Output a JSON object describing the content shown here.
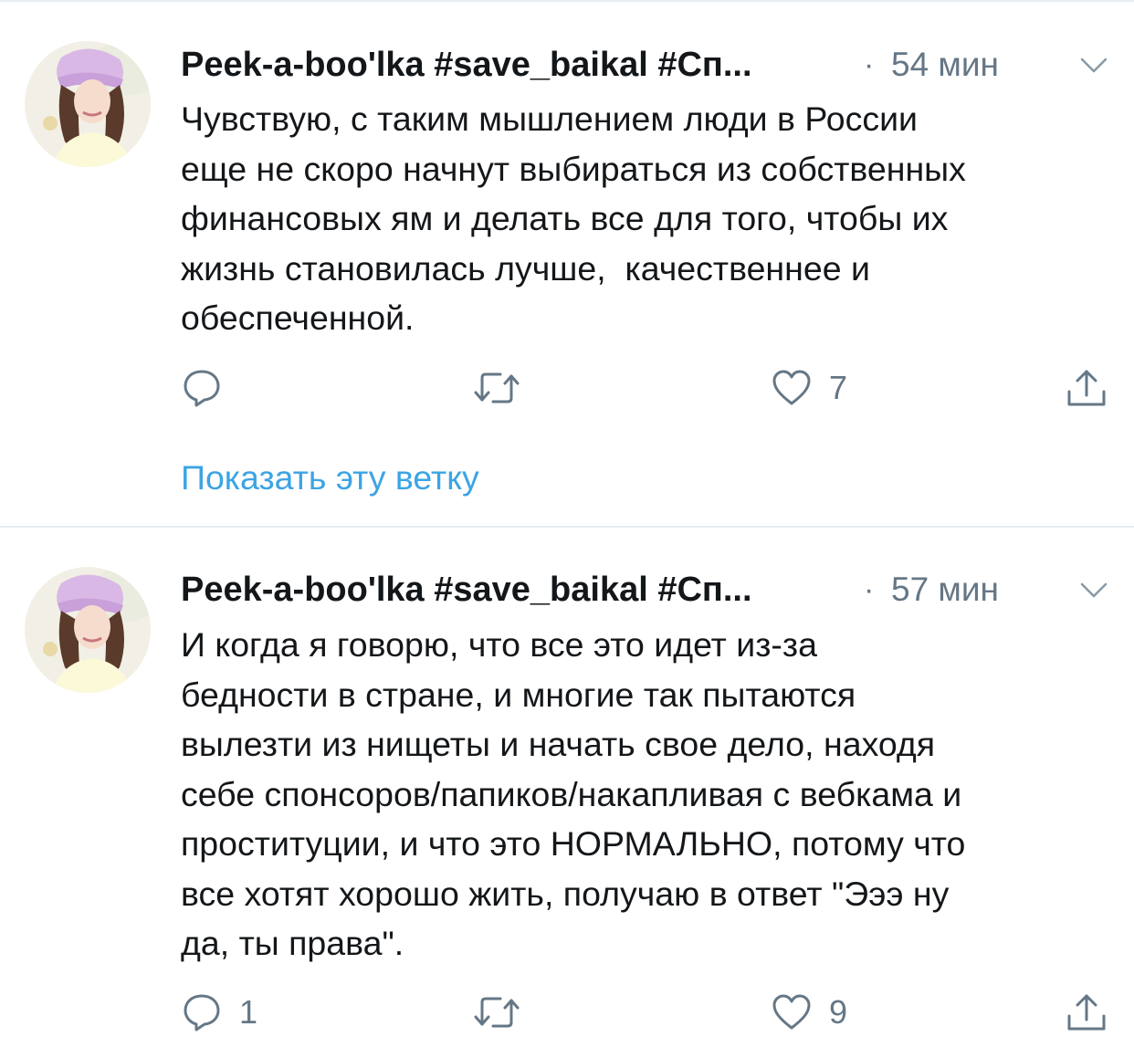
{
  "tweets": [
    {
      "author": "Peek-a-boo'lka #save_baikal #Сп...",
      "separator": "·",
      "time": "54 мин",
      "text": "Чувствую, с таким мышлением люди в России\nеще не скоро начнут выбираться из собственных\nфинансовых ям и делать все для того, чтобы их\nжизнь становилась лучше,  качественнее и\nобеспеченной.",
      "replies": "",
      "retweets": "",
      "likes": "7",
      "show_thread": "Показать эту ветку"
    },
    {
      "author": "Peek-a-boo'lka #save_baikal #Сп...",
      "separator": "·",
      "time": "57 мин",
      "text": "И когда я говорю, что все это идет из-за\nбедности в стране, и многие так пытаются\nвылезти из нищеты и начать свое дело, находя\nсебе спонсоров/папиков/накапливая с вебкама и\nпроституции, и что это НОРМАЛЬНО, потому что\nвсе хотят хорошо жить, получаю в ответ \"Эээ ну\nда, ты права\".",
      "replies": "1",
      "retweets": "",
      "likes": "9"
    }
  ],
  "colors": {
    "text": "#14171a",
    "secondary": "#657786",
    "link": "#1b95e0",
    "divider": "#e6ecf0"
  },
  "icons": [
    "reply-icon",
    "retweet-icon",
    "like-icon",
    "share-icon",
    "chevron-down-icon"
  ]
}
